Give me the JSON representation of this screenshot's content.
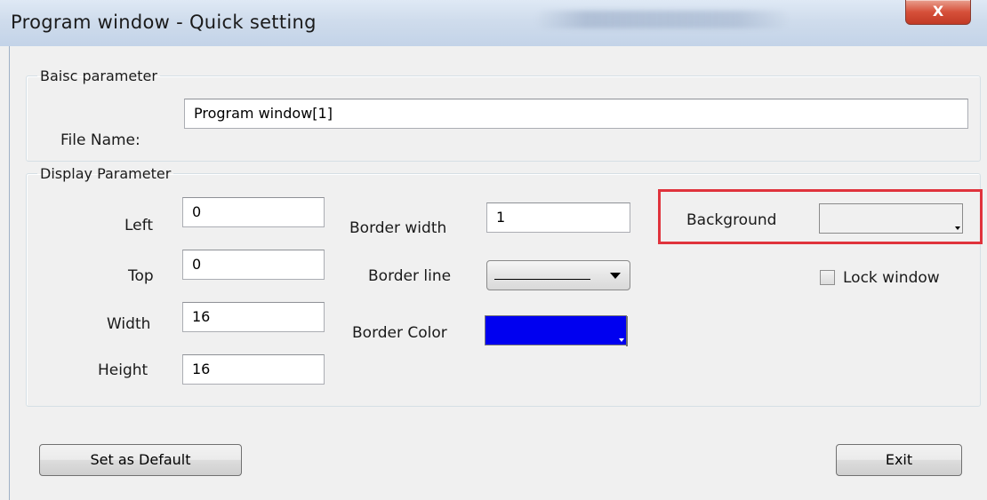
{
  "window": {
    "title": "Program window - Quick setting",
    "close_glyph": "X",
    "close_icon": "close-icon"
  },
  "basic": {
    "legend": "Baisc parameter",
    "file_name_label": "File Name:",
    "file_name_value": "Program window[1]"
  },
  "display": {
    "legend": "Display Parameter",
    "left_label": "Left",
    "left_value": "0",
    "top_label": "Top",
    "top_value": "0",
    "width_label": "Width",
    "width_value": "16",
    "height_label": "Height",
    "height_value": "16",
    "border_width_label": "Border width",
    "border_width_value": "1",
    "border_line_label": "Border line",
    "border_color_label": "Border Color",
    "border_color_value": "#0000f0",
    "background_label": "Background",
    "lock_window_label": "Lock window",
    "lock_window_checked": false
  },
  "buttons": {
    "set_default": "Set as Default",
    "exit": "Exit"
  },
  "colors": {
    "highlight": "#e0333c",
    "close_button": "#d6503a"
  }
}
